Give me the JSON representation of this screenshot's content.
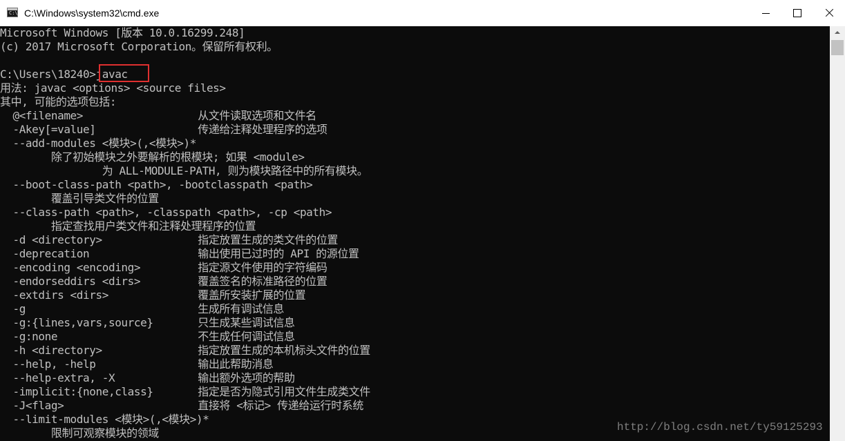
{
  "window": {
    "title": "C:\\Windows\\system32\\cmd.exe",
    "app_icon_text": "C:\\",
    "minimize_icon": "minimize-icon",
    "maximize_icon": "maximize-icon",
    "close_icon": "close-icon"
  },
  "console": {
    "lines": [
      "Microsoft Windows [版本 10.0.16299.248]",
      "(c) 2017 Microsoft Corporation。保留所有权利。",
      "",
      "C:\\Users\\18240>javac",
      "用法: javac <options> <source files>",
      "其中, 可能的选项包括:",
      "  @<filename>                  从文件读取选项和文件名",
      "  -Akey[=value]                传递给注释处理程序的选项",
      "  --add-modules <模块>(,<模块>)*",
      "        除了初始模块之外要解析的根模块; 如果 <module>",
      "                为 ALL-MODULE-PATH, 则为模块路径中的所有模块。",
      "  --boot-class-path <path>, -bootclasspath <path>",
      "        覆盖引导类文件的位置",
      "  --class-path <path>, -classpath <path>, -cp <path>",
      "        指定查找用户类文件和注释处理程序的位置",
      "  -d <directory>               指定放置生成的类文件的位置",
      "  -deprecation                 输出使用已过时的 API 的源位置",
      "  -encoding <encoding>         指定源文件使用的字符编码",
      "  -endorseddirs <dirs>         覆盖签名的标准路径的位置",
      "  -extdirs <dirs>              覆盖所安装扩展的位置",
      "  -g                           生成所有调试信息",
      "  -g:{lines,vars,source}       只生成某些调试信息",
      "  -g:none                      不生成任何调试信息",
      "  -h <directory>               指定放置生成的本机标头文件的位置",
      "  --help, -help                输出此帮助消息",
      "  --help-extra, -X             输出额外选项的帮助",
      "  -implicit:{none,class}       指定是否为隐式引用文件生成类文件",
      "  -J<flag>                     直接将 <标记> 传递给运行时系统",
      "  --limit-modules <模块>(,<模块>)*",
      "        限制可观察模块的领域"
    ],
    "watermark": "http://blog.csdn.net/ty59125293"
  },
  "colors": {
    "console_bg": "#0c0c0c",
    "console_text": "#c0c0c0",
    "highlight_border": "#e03030"
  }
}
